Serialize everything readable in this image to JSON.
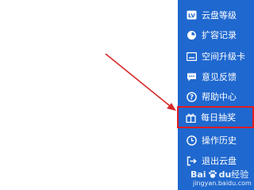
{
  "menu": {
    "items": [
      {
        "label": "云盘等级",
        "icon": "level-badge-icon"
      },
      {
        "label": "扩容记录",
        "icon": "pie-clock-icon"
      },
      {
        "label": "空间升级卡",
        "icon": "card-icon"
      },
      {
        "label": "意见反馈",
        "icon": "chat-bubble-icon"
      },
      {
        "label": "帮助中心",
        "icon": "question-icon"
      },
      {
        "label": "每日抽奖",
        "icon": "gift-icon"
      },
      {
        "label": "操作历史",
        "icon": "clock-icon"
      },
      {
        "label": "退出云盘",
        "icon": "exit-icon"
      }
    ],
    "highlighted_item": "每日抽奖",
    "background_color": "#1f68cf",
    "highlight_color": "#e11b22"
  },
  "annotation": {
    "arrow_color": "#d42a2a"
  },
  "watermark": {
    "logo_text": "Bai",
    "logo_suffix": "du",
    "logo_tail": "经验",
    "url": "jingyan.baidu.com"
  }
}
